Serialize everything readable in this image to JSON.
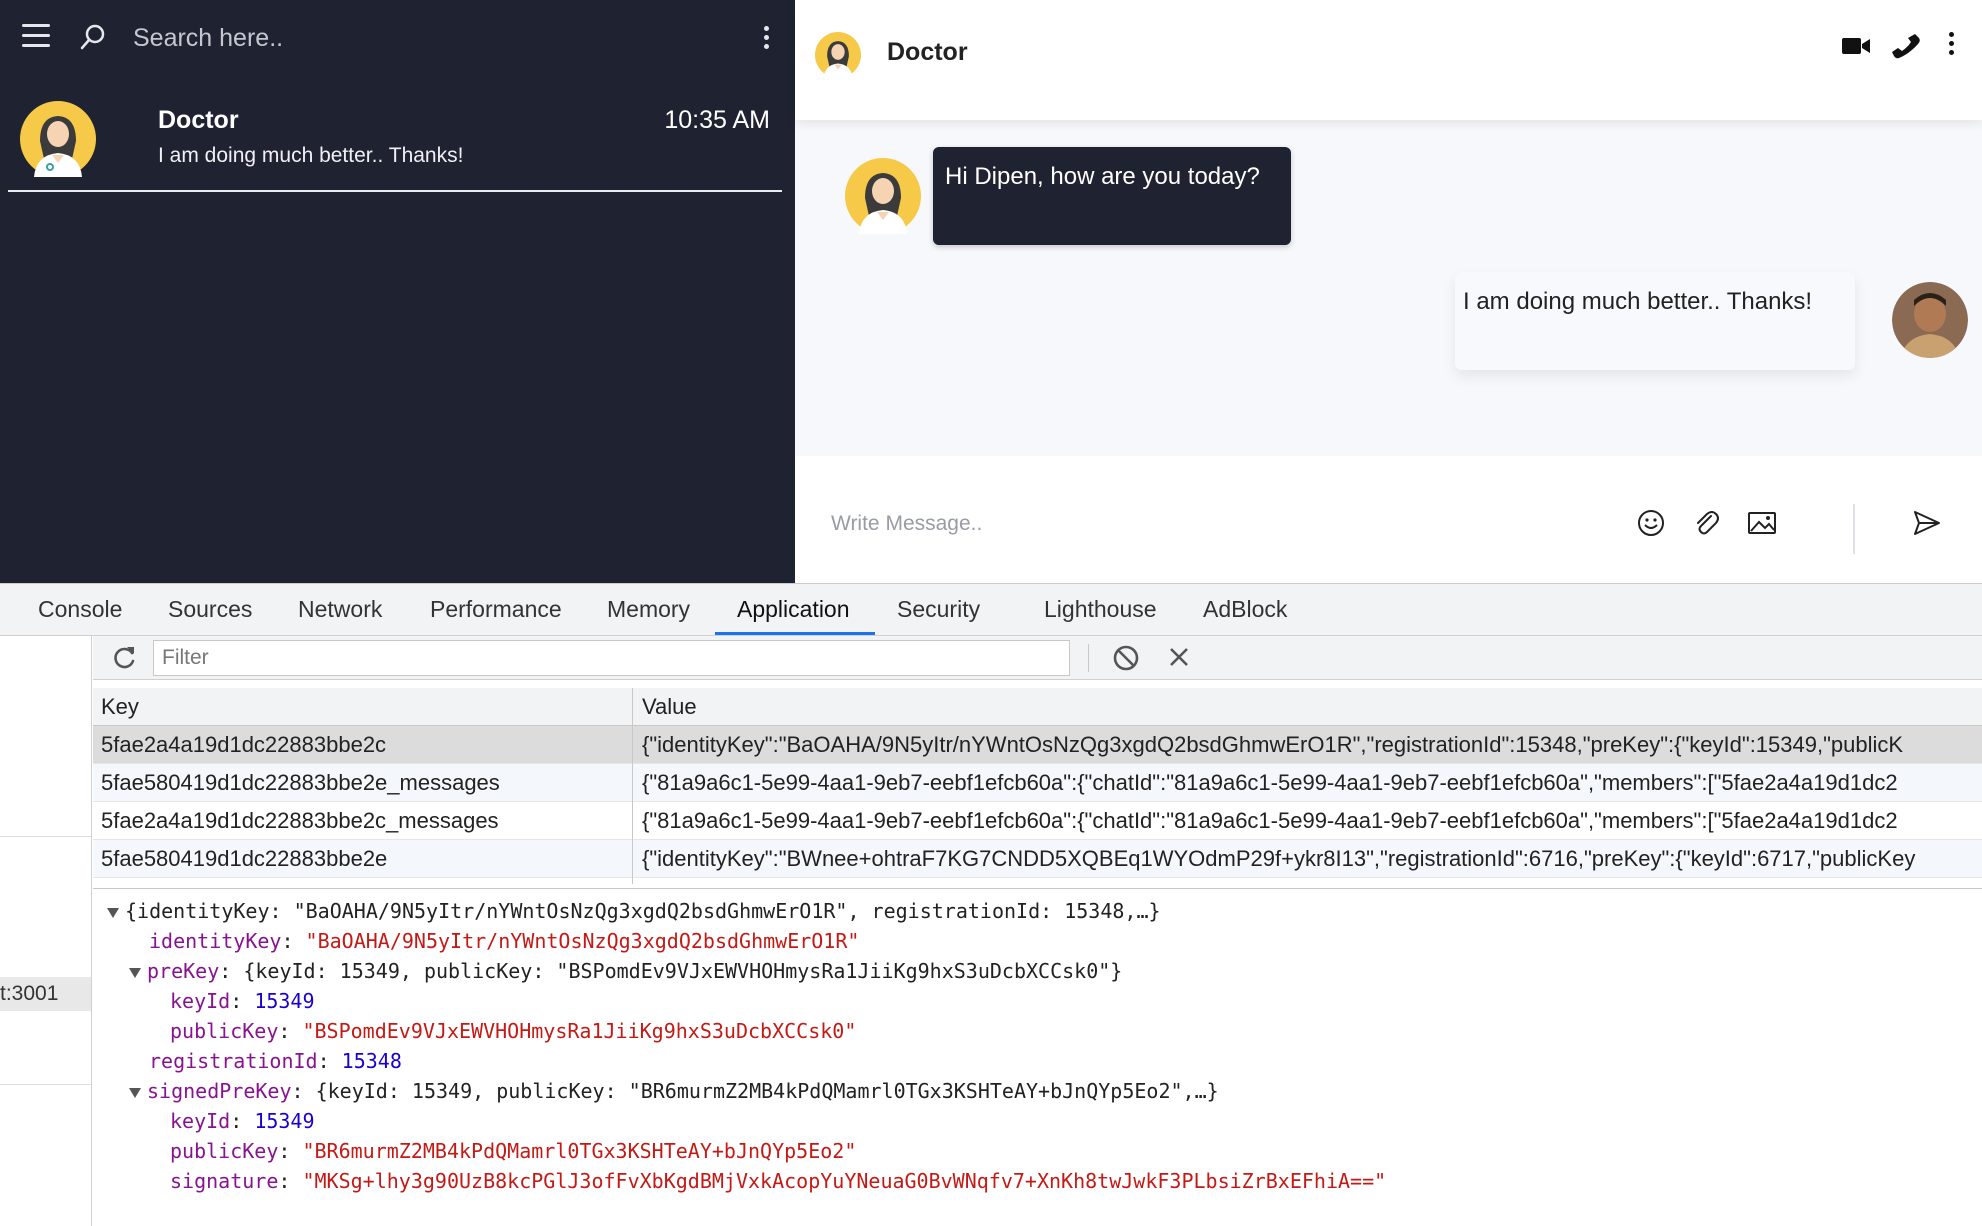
{
  "sidebar": {
    "search_placeholder": "Search here..",
    "chat": {
      "name": "Doctor",
      "time": "10:35 AM",
      "preview": "I am doing much better.. Thanks!"
    }
  },
  "chat": {
    "title": "Doctor",
    "messages": [
      {
        "from": "doctor",
        "text": "Hi Dipen, how are you today?"
      },
      {
        "from": "me",
        "text": "I am doing much better.. Thanks!"
      }
    ],
    "composer_placeholder": "Write Message.."
  },
  "devtools": {
    "tabs": [
      "Console",
      "Sources",
      "Network",
      "Performance",
      "Memory",
      "Application",
      "Security",
      "Lighthouse",
      "AdBlock"
    ],
    "active_tab": "Application",
    "sidebar_origin": "t:3001",
    "filter_placeholder": "Filter",
    "columns": [
      "Key",
      "Value"
    ],
    "rows": [
      {
        "key": "5fae2a4a19d1dc22883bbe2c",
        "value": "{\"identityKey\":\"BaOAHA/9N5yItr/nYWntOsNzQg3xgdQ2bsdGhmwErO1R\",\"registrationId\":15348,\"preKey\":{\"keyId\":15349,\"publicK"
      },
      {
        "key": "5fae580419d1dc22883bbe2e_messages",
        "value": "{\"81a9a6c1-5e99-4aa1-9eb7-eebf1efcb60a\":{\"chatId\":\"81a9a6c1-5e99-4aa1-9eb7-eebf1efcb60a\",\"members\":[\"5fae2a4a19d1dc2"
      },
      {
        "key": "5fae2a4a19d1dc22883bbe2c_messages",
        "value": "{\"81a9a6c1-5e99-4aa1-9eb7-eebf1efcb60a\":{\"chatId\":\"81a9a6c1-5e99-4aa1-9eb7-eebf1efcb60a\",\"members\":[\"5fae2a4a19d1dc2"
      },
      {
        "key": "5fae580419d1dc22883bbe2e",
        "value": "{\"identityKey\":\"BWnee+ohtraF7KG7CNDD5XQBEq1WYOdmP29f+ykr8I13\",\"registrationId\":6716,\"preKey\":{\"keyId\":6717,\"publicKey"
      }
    ],
    "preview": {
      "summary": "{identityKey: \"BaOAHA/9N5yItr/nYWntOsNzQg3xgdQ2bsdGhmwErO1R\", registrationId: 15348,…}",
      "identityKey": "\"BaOAHA/9N5yItr/nYWntOsNzQg3xgdQ2bsdGhmwErO1R\"",
      "preKey_summary": "{keyId: 15349, publicKey: \"BSPomdEv9VJxEWVHOHmysRa1JiiKg9hxS3uDcbXCCsk0\"}",
      "preKey_keyId": "15349",
      "preKey_publicKey": "\"BSPomdEv9VJxEWVHOHmysRa1JiiKg9hxS3uDcbXCCsk0\"",
      "registrationId": "15348",
      "signedPreKey_summary": "{keyId: 15349, publicKey: \"BR6murmZ2MB4kPdQMamrl0TGx3KSHTeAY+bJnQYp5Eo2\",…}",
      "signedPreKey_keyId": "15349",
      "signedPreKey_publicKey": "\"BR6murmZ2MB4kPdQMamrl0TGx3KSHTeAY+bJnQYp5Eo2\"",
      "signedPreKey_signature": "\"MKSg+lhy3g90UzB8kcPGlJ3ofFvXbKgdBMjVxkAcopYuYNeuaG0BvWNqfv7+XnKh8twJwkF3PLbsiZrBxEFhiA==\""
    }
  }
}
